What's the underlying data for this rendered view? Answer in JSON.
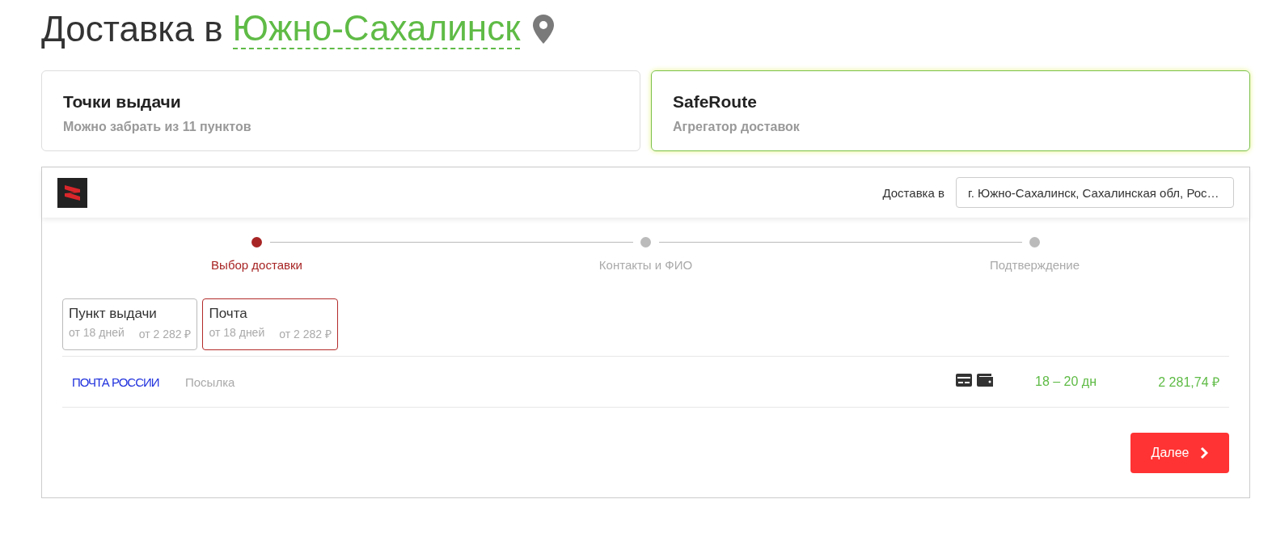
{
  "heading": {
    "prefix": "Доставка в",
    "city": "Южно-Сахалинск"
  },
  "methods": [
    {
      "title": "Точки выдачи",
      "subtitle": "Можно забрать из 11 пунктов",
      "selected": false
    },
    {
      "title": "SafeRoute",
      "subtitle": "Агрегатор доставок",
      "selected": true
    }
  ],
  "widget": {
    "address_label": "Доставка в",
    "address_value": "г. Южно-Сахалинск, Сахалинская обл,  Рос…",
    "steps": [
      {
        "label": "Выбор доставки",
        "selected": true
      },
      {
        "label": "Контакты и ФИО",
        "selected": false
      },
      {
        "label": "Подтверждение",
        "selected": false
      }
    ],
    "tabs": [
      {
        "label": "Пункт выдачи",
        "days": "от 18 дней",
        "price": "от 2 282 ₽",
        "selected": false
      },
      {
        "label": "Почта",
        "days": "от 18 дней",
        "price": "от 2 282 ₽",
        "selected": true
      }
    ],
    "offers": [
      {
        "carrier": "ПОЧТА РОССИИ",
        "service": "Посылка",
        "term": "18 – 20 дн",
        "price": "2 281,74 ₽"
      }
    ],
    "next_button": "Далее"
  }
}
